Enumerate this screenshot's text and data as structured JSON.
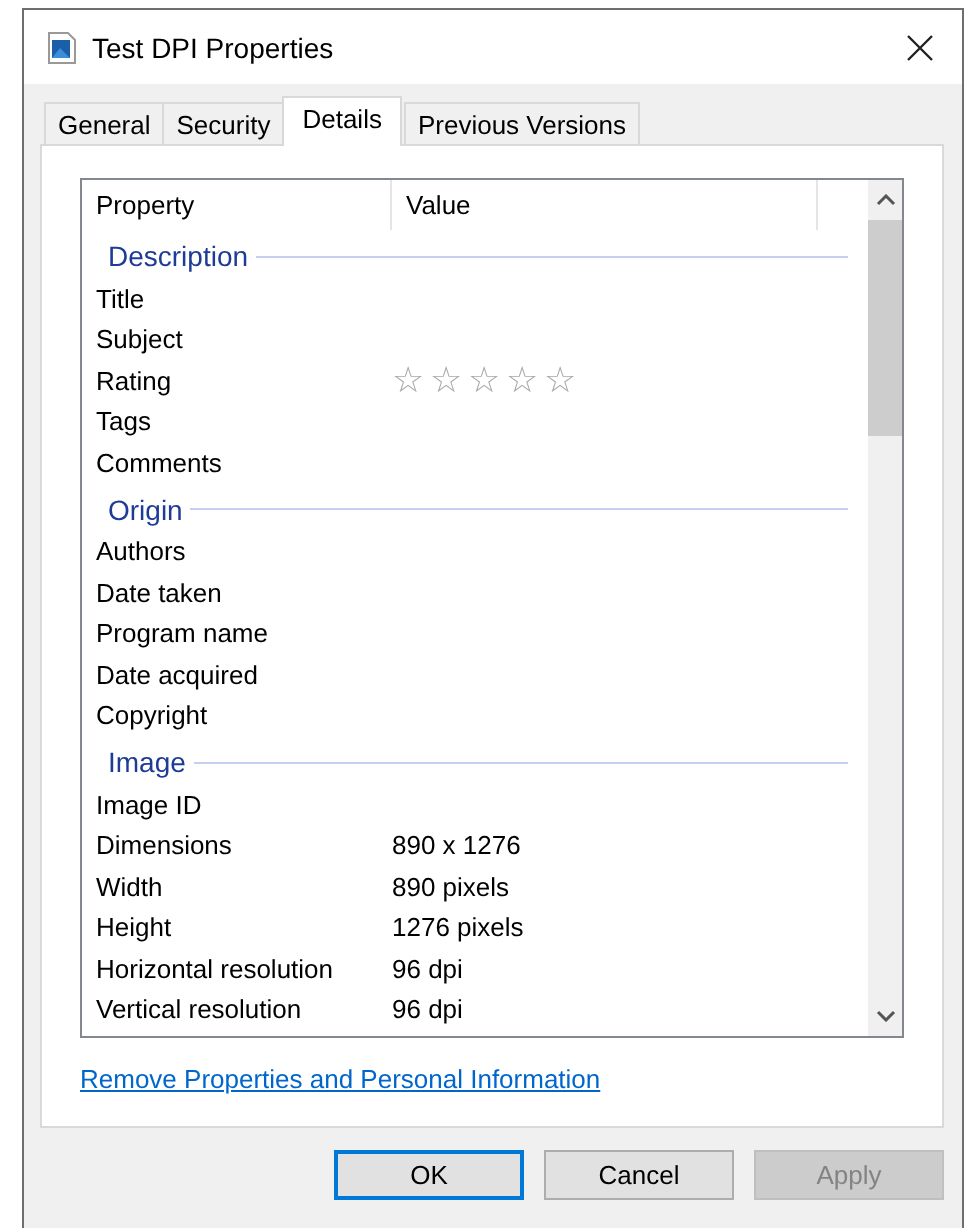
{
  "window": {
    "title": "Test DPI Properties"
  },
  "tabs": [
    {
      "label": "General",
      "selected": false
    },
    {
      "label": "Security",
      "selected": false
    },
    {
      "label": "Details",
      "selected": true
    },
    {
      "label": "Previous Versions",
      "selected": false
    }
  ],
  "table": {
    "columns": [
      "Property",
      "Value"
    ],
    "groups": [
      {
        "title": "Description",
        "rows": [
          {
            "kind": "text",
            "property": "Title"
          },
          {
            "kind": "text",
            "property": "Subject"
          },
          {
            "kind": "stars",
            "property": "Rating",
            "stars": 0
          },
          {
            "kind": "text",
            "property": "Tags"
          },
          {
            "kind": "text",
            "property": "Comments"
          }
        ]
      },
      {
        "title": "Origin",
        "rows": [
          {
            "kind": "text",
            "property": "Authors"
          },
          {
            "kind": "text",
            "property": "Date taken"
          },
          {
            "kind": "text",
            "property": "Program name"
          },
          {
            "kind": "text",
            "property": "Date acquired"
          },
          {
            "kind": "text",
            "property": "Copyright"
          }
        ]
      },
      {
        "title": "Image",
        "rows": [
          {
            "kind": "text",
            "property": "Image ID"
          },
          {
            "kind": "text",
            "property": "Dimensions",
            "value": "890 x 1276"
          },
          {
            "kind": "text",
            "property": "Width",
            "value": "890 pixels"
          },
          {
            "kind": "text",
            "property": "Height",
            "value": "1276 pixels"
          },
          {
            "kind": "text",
            "property": "Horizontal resolution",
            "value": "96 dpi"
          },
          {
            "kind": "text",
            "property": "Vertical resolution",
            "value": "96 dpi"
          }
        ]
      }
    ]
  },
  "link": "Remove Properties and Personal Information",
  "buttons": [
    {
      "label": "OK",
      "default": true,
      "disabled": false
    },
    {
      "label": "Cancel",
      "default": false,
      "disabled": false
    },
    {
      "label": "Apply",
      "default": false,
      "disabled": true
    }
  ]
}
